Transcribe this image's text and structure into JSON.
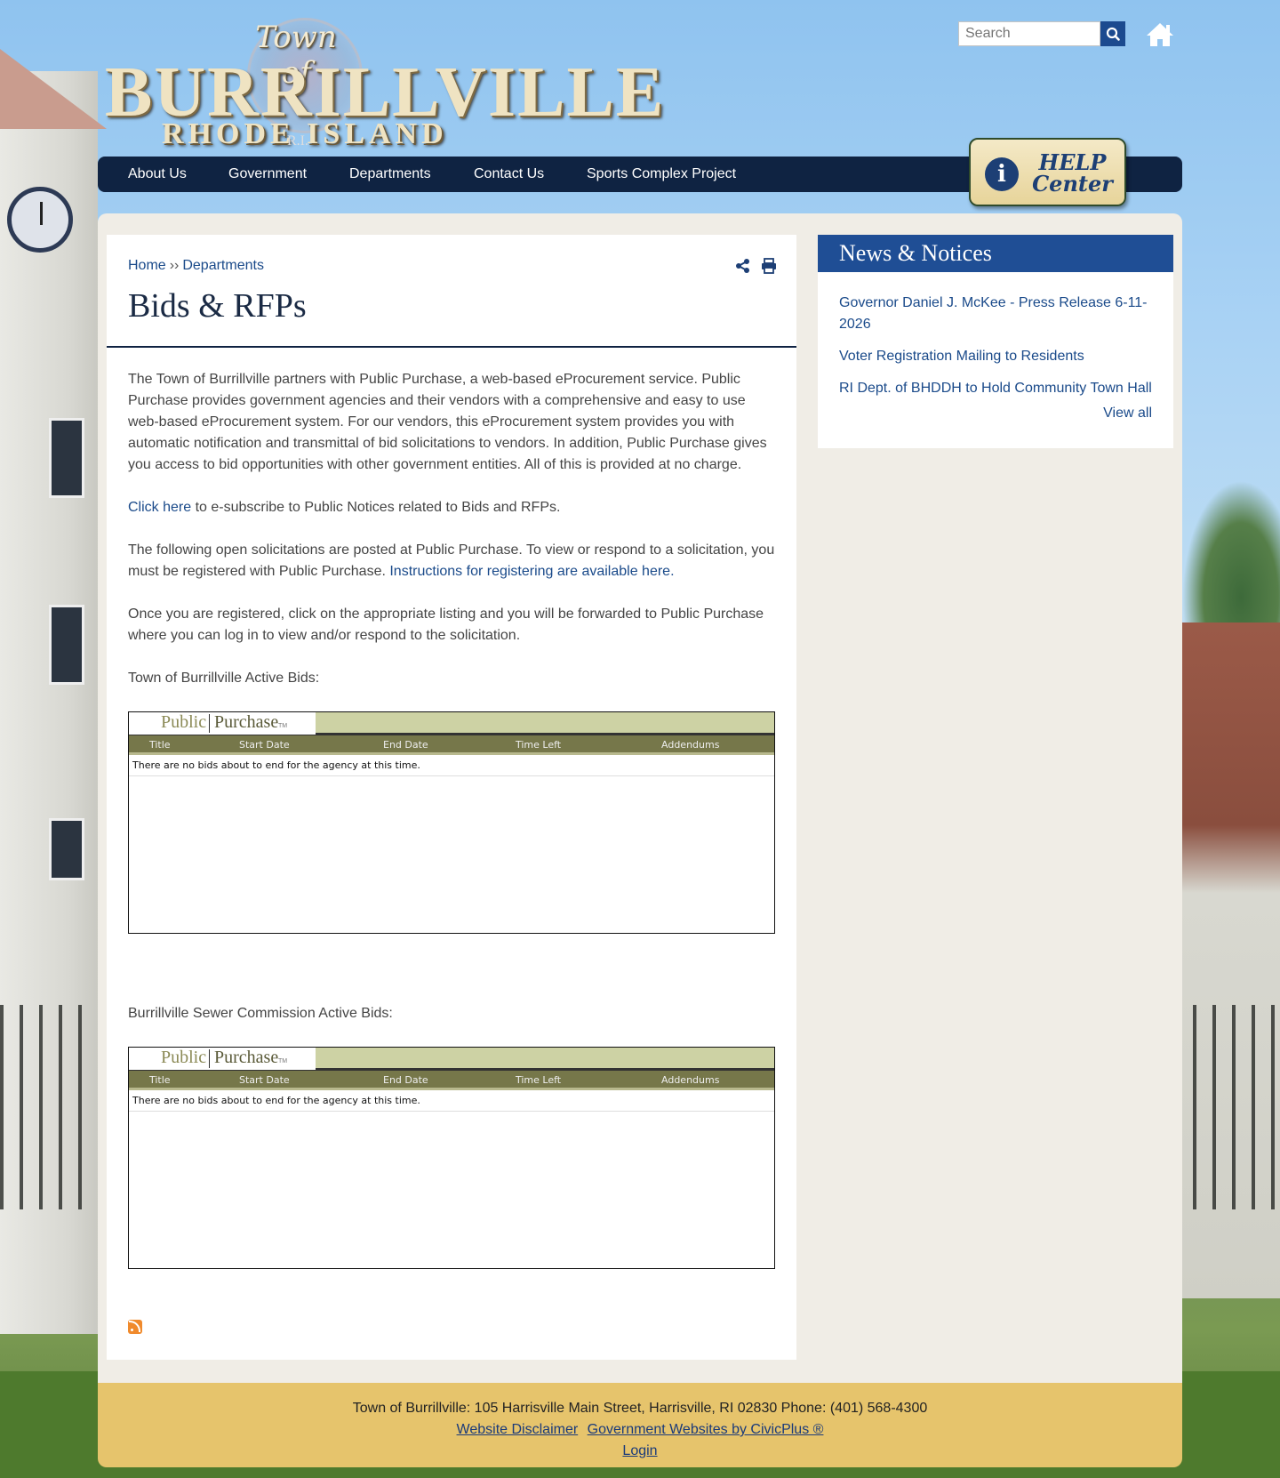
{
  "header": {
    "logo": {
      "town_of": "Town of",
      "main": "BURRILLVILLE",
      "sub": "RHODE ISLAND",
      "ri": "R.I."
    },
    "search": {
      "placeholder": "Search"
    },
    "icons": {
      "search": "search-icon",
      "home": "home-icon"
    }
  },
  "nav": {
    "items": [
      "About Us",
      "Government",
      "Departments",
      "Contact Us",
      "Sports Complex Project"
    ]
  },
  "help_center": {
    "line1": "HELP",
    "line2": "Center",
    "icon": "info-icon"
  },
  "breadcrumb": {
    "home": "Home",
    "separator": "››",
    "current": "Departments"
  },
  "page": {
    "title": "Bids & RFPs",
    "para1": "The Town of Burrillville partners with Public Purchase, a web-based eProcurement service. Public Purchase provides government agencies and their vendors with a comprehensive and easy to use web-based eProcurement system. For our vendors, this eProcurement system provides you with automatic notification and transmittal of bid solicitations to vendors. In addition, Public Purchase gives you access to bid opportunities with other government entities. All of this is provided at no charge.",
    "para2_link": "Click here",
    "para2_rest": " to e-subscribe to Public Notices related to Bids and RFPs.",
    "para3_text": "The following open solicitations are posted at Public Purchase. To view or respond to a solicitation, you must be registered with Public Purchase. ",
    "para3_link": "Instructions for registering are available here.",
    "para4": "Once you are registered, click on the appropriate listing and you will be forwarded to Public Purchase where you can log in to view and/or respond to the solicitation.",
    "section1_label": "Town of Burrillville Active Bids:",
    "section2_label": "Burrillville Sewer Commission Active Bids:"
  },
  "public_purchase": {
    "logo_left": "Public",
    "logo_right": "Purchase",
    "logo_tm": "TM",
    "columns": [
      "Title",
      "Start Date",
      "End Date",
      "Time Left",
      "Addendums"
    ],
    "empty_message": "There are no bids about to end for the agency at this time."
  },
  "sidebar": {
    "heading": "News & Notices",
    "items": [
      "Governor Daniel J. McKee - Press Release 6-11-2026",
      "Voter Registration Mailing to Residents",
      "RI Dept. of BHDDH to Hold Community Town Hall"
    ],
    "view_all": "View all"
  },
  "footer": {
    "address": "Town of Burrillville: 105 Harrisville Main Street, Harrisville, RI 02830  Phone: (401) 568-4300",
    "disclaimer": "Website Disclaimer",
    "civicplus": "Government Websites by CivicPlus ®",
    "login": "Login"
  },
  "colors": {
    "nav_bg": "#0f2342",
    "link": "#1a4a8a",
    "sidebar_head": "#1f4e95",
    "footer_bg": "#e6c46c",
    "pp_header": "#76774a"
  }
}
